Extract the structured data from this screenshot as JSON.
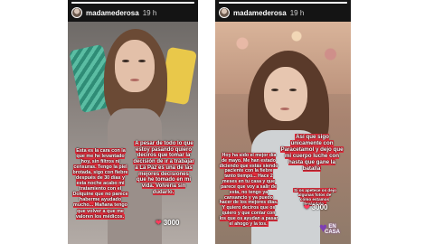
{
  "stories": [
    {
      "username": "madamederosa",
      "time": "19 h",
      "caption_left": "Esta es la cara con la que me he levantado hoy, sin filtros ni censuras. Tengo la piel brotada, sigo con fiebre después de 30 días y esta noche acabo mi tratamiento con el Dolquine que no parece haberme ayudado mucho... Mañana tengo que volver a que me valoren los médicos.",
      "caption_right": "A pesar de todo lo que estoy pasando quiero deciros que tomar la decisión de ir a trabajar a La Paz es una de las mejores decisiones que he tomado en mi vida. Volvería sin dudarlo.",
      "count": "3000"
    },
    {
      "username": "madamederosa",
      "time": "19 h",
      "caption_left": "Hoy ha sido el mejor día de mayo. Me han estado diciendo que estás siendo paciente con la fiebre tanto tiempo... Hace 2 meses en tu casa y que parece que voy a salir de esta, no tengo ya cansancio y ya puedo hacer de los mejores días. Y quiero deciros que os quiero y que contar con los que os ayudan a pasar el ahogo y la tos.",
      "caption_right": "Así que sigo únicamente con Paracetamol y dejo que mi cuerpo luche con hasta que gane la batalla",
      "caption_small": "Si os apetece os dejo algunas fotos de cómo estamos llevándolo.",
      "count": "3000",
      "sticker": "EN CASA"
    }
  ],
  "colors": {
    "highlight": "#e6303f",
    "heart": "#ff3b5c",
    "sticker": "#7e3fb3"
  },
  "icons": {
    "like": "heart-icon",
    "sticker": "heart-sticker-icon"
  }
}
